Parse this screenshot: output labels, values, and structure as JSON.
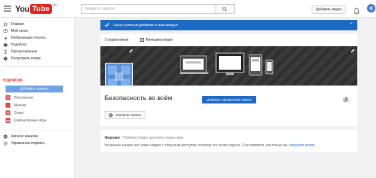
{
  "header": {
    "logo_you": "You",
    "logo_tube": "Tube",
    "logo_region": "RU",
    "search_placeholder": "Введите запрос",
    "add_video_label": "Добавить видео"
  },
  "sidebar": {
    "items": [
      {
        "label": "Главная",
        "icon": "home-icon"
      },
      {
        "label": "Мой канал",
        "icon": "account-icon"
      },
      {
        "label": "Набирающие популя...",
        "icon": "flame-icon"
      },
      {
        "label": "Подписки",
        "icon": "subscriptions-icon"
      },
      {
        "label": "Просмотренные",
        "icon": "hourglass-icon"
      },
      {
        "label": "Посмотреть позже",
        "icon": "clock-icon"
      }
    ],
    "subscriptions_title": "ПОДПИСКИ",
    "add_channels_label": "Добавить каналы",
    "subscription_items": [
      {
        "label": "Популярное",
        "color": "#e8484a"
      },
      {
        "label": "Музыка",
        "color": "#e03a3a"
      },
      {
        "label": "Спорт",
        "color": "#e0524a"
      },
      {
        "label": "Компьютерные игры",
        "color": "#d9434a"
      }
    ],
    "footer_items": [
      {
        "label": "Каталог каналов",
        "icon": "plus-circle-icon"
      },
      {
        "label": "Управление подписк...",
        "icon": "gear-icon"
      }
    ]
  },
  "alert": {
    "message": "Канал успешно добавлен в ваш аккаунт.",
    "close": "×"
  },
  "channel": {
    "subscribers": "0 подписчиков",
    "video_manager": "Менеджер видео",
    "add_art_label": "Добавить оформление канала",
    "title": "Безопасность во всём",
    "description_label": "Описание канала"
  },
  "uploads": {
    "heading": "Загрузки",
    "note": "Плейлист будет доступен только вам.",
    "message": "На вашем канале нет новых видео с открытым доступом, поэтому эта полка скрыта. Она появится, как только вы",
    "link": "загрузите ролик."
  },
  "colors": {
    "brand_red": "#e62117",
    "accent_blue": "#1d6ac5"
  }
}
